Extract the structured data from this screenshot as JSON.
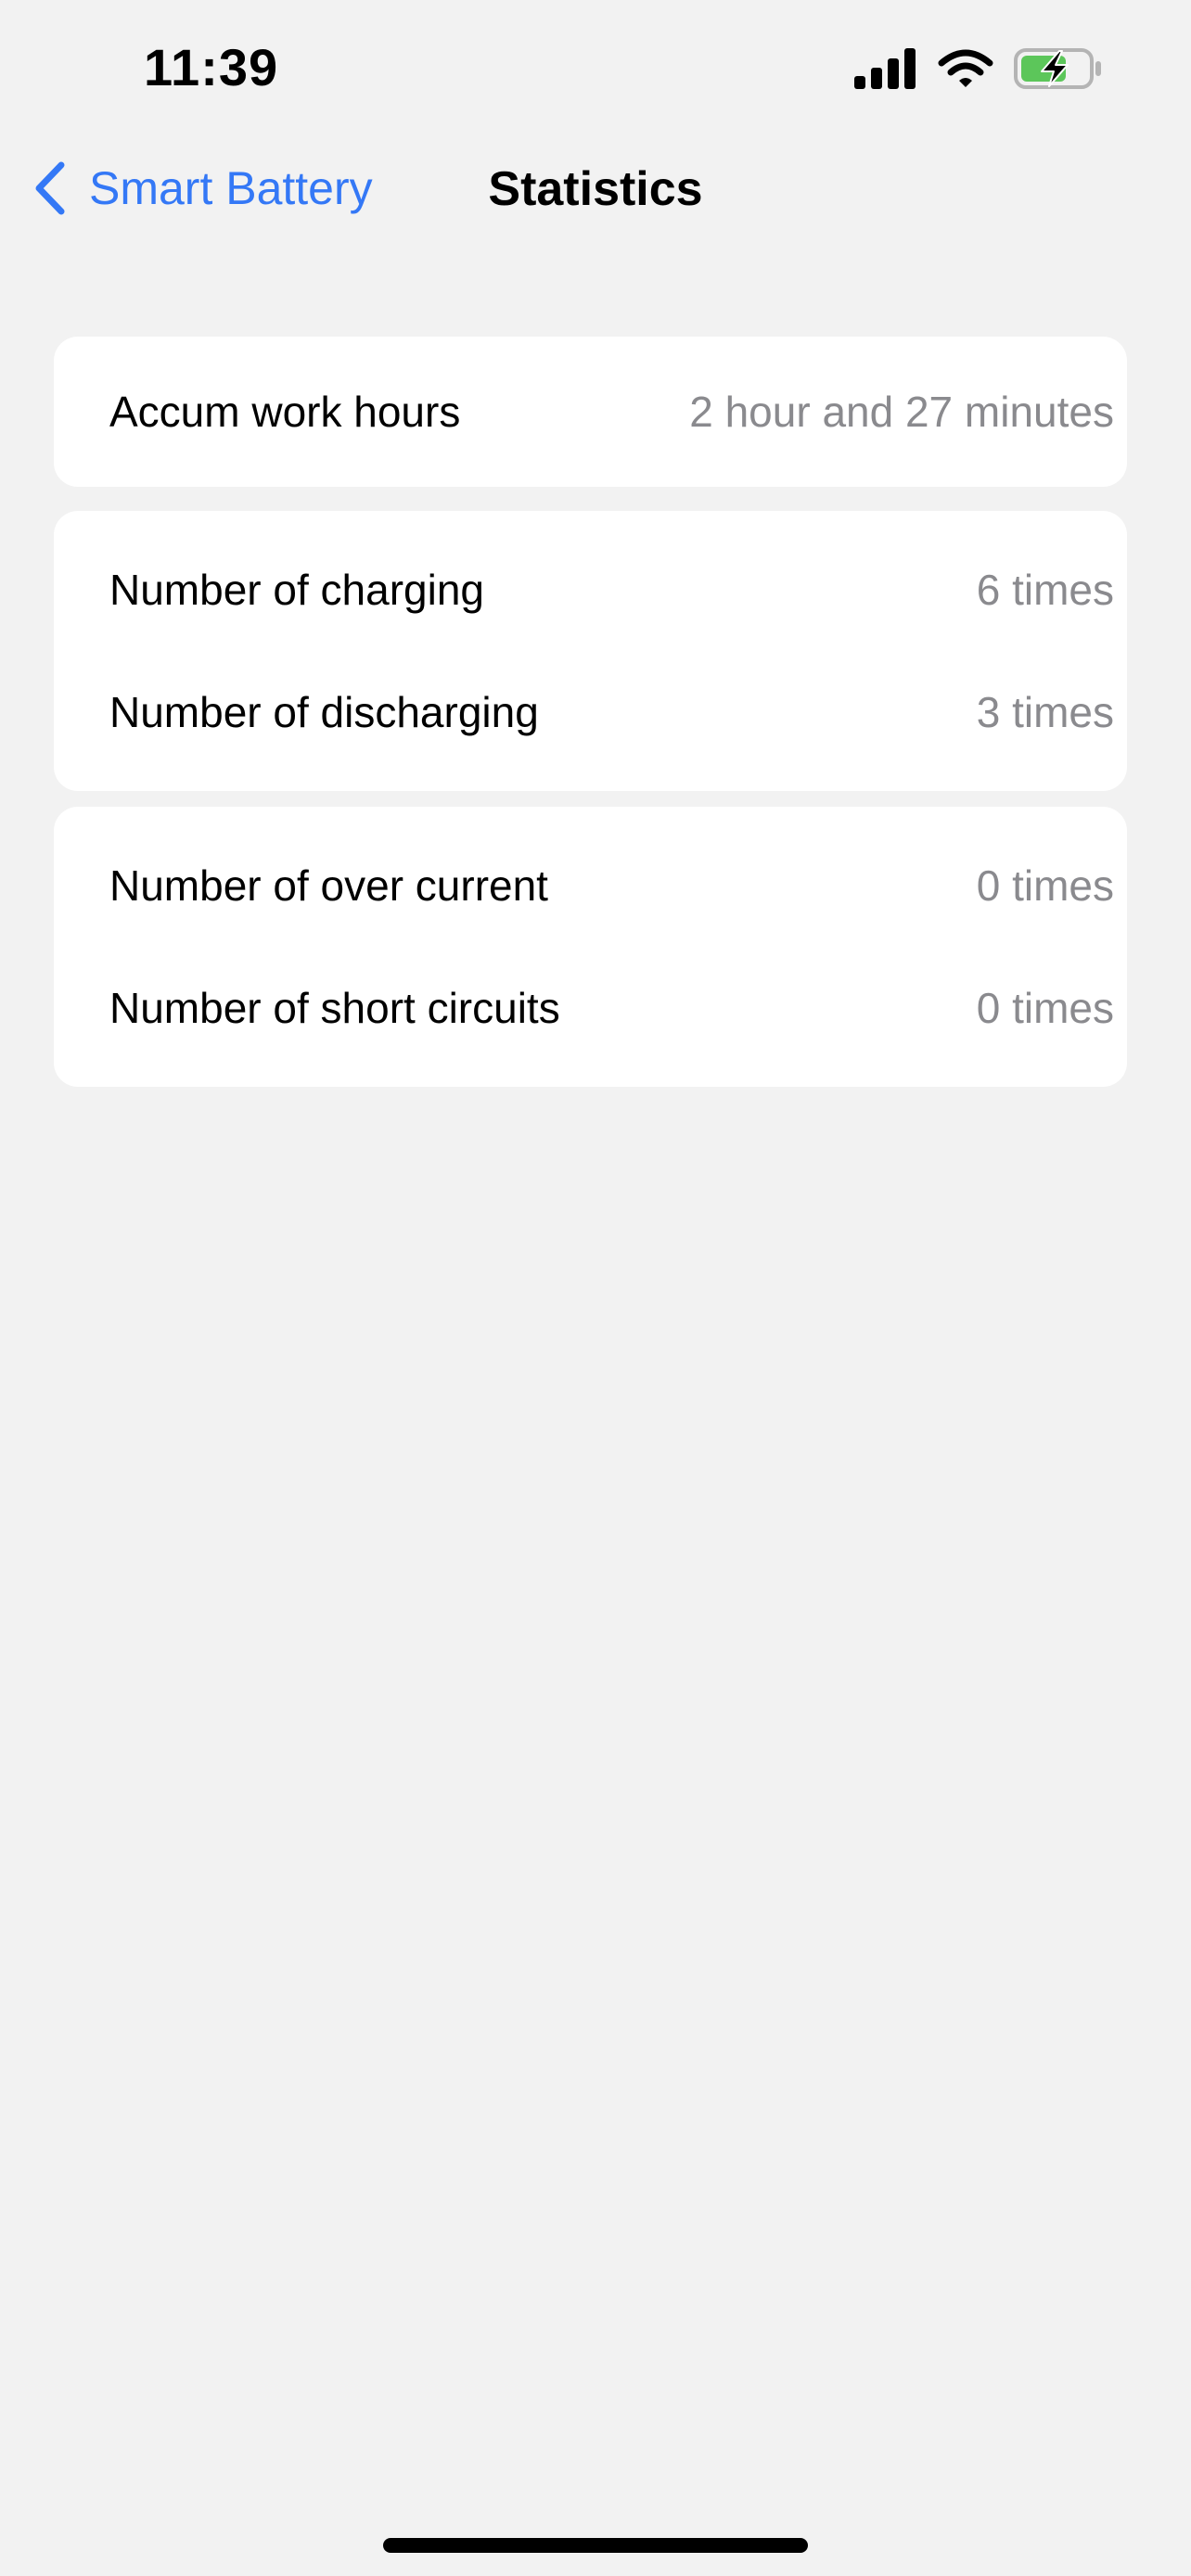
{
  "status_bar": {
    "time": "11:39",
    "battery_fill_color": "#5cc65a",
    "icons": [
      "cellular-signal-icon",
      "wifi-icon",
      "battery-charging-icon"
    ]
  },
  "nav": {
    "back_label": "Smart Battery",
    "title": "Statistics",
    "accent_color": "#3478f6"
  },
  "groups": [
    {
      "rows": [
        {
          "label": "Accum work hours",
          "value": "2 hour and 27 minutes"
        }
      ]
    },
    {
      "rows": [
        {
          "label": "Number of charging",
          "value": "6 times"
        },
        {
          "label": "Number of discharging",
          "value": "3 times"
        }
      ]
    },
    {
      "rows": [
        {
          "label": "Number of over current",
          "value": "0 times"
        },
        {
          "label": "Number of short circuits",
          "value": "0 times"
        }
      ]
    }
  ]
}
